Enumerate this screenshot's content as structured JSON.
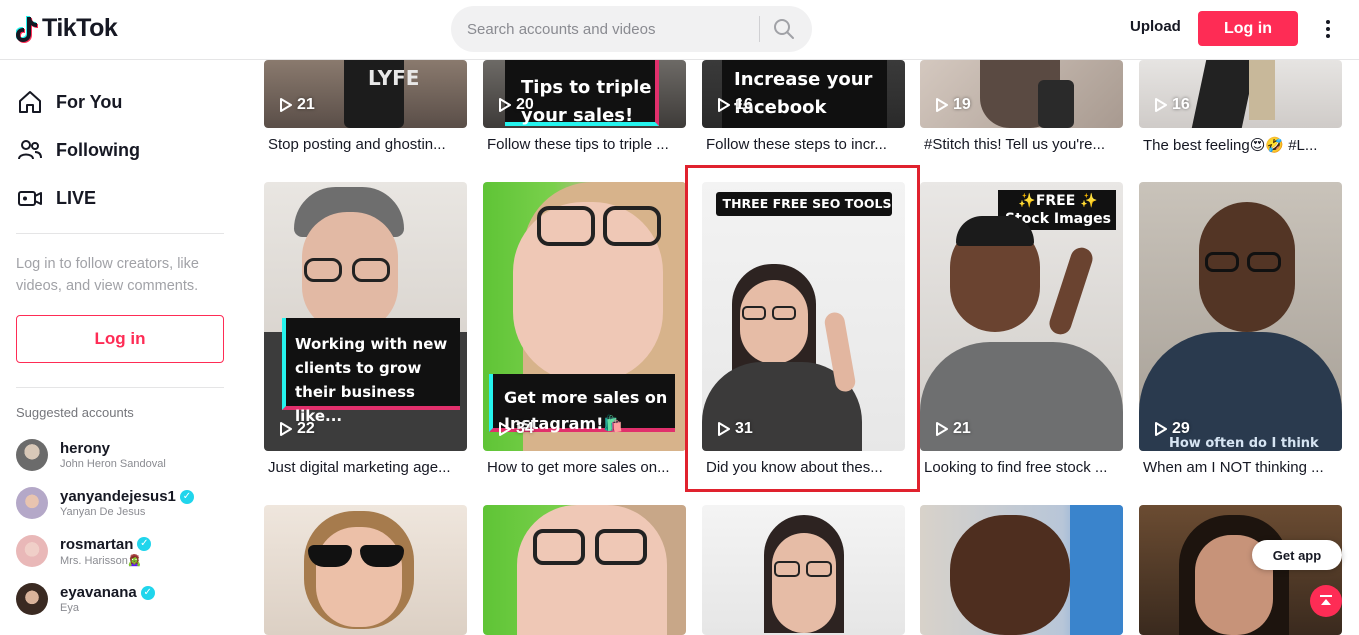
{
  "header": {
    "logo_text": "TikTok",
    "search_placeholder": "Search accounts and videos",
    "upload_label": "Upload",
    "login_label": "Log in"
  },
  "sidebar": {
    "nav": [
      {
        "label": "For You",
        "icon": "home-icon"
      },
      {
        "label": "Following",
        "icon": "users-icon"
      },
      {
        "label": "LIVE",
        "icon": "live-camera-icon"
      }
    ],
    "hint": "Log in to follow creators, like videos, and view comments.",
    "login_label": "Log in",
    "suggested_title": "Suggested accounts",
    "accounts": [
      {
        "username": "herony",
        "name": "John Heron Sandoval",
        "verified": false
      },
      {
        "username": "yanyandejesus1",
        "name": "Yanyan De Jesus",
        "verified": true
      },
      {
        "username": "rosmartan",
        "name": "Mrs. Harisson🧟‍♀️",
        "verified": true
      },
      {
        "username": "eyavanana",
        "name": "Eya",
        "verified": true
      }
    ]
  },
  "videos": [
    {
      "views": "21",
      "caption": "Stop posting and ghostin...",
      "overlay": "LYFE"
    },
    {
      "views": "20",
      "caption": "Follow these tips to triple ...",
      "overlay": "Tips to triple your sales!"
    },
    {
      "views": "16",
      "caption": "Follow these steps to incr...",
      "overlay": "Increase your facebook"
    },
    {
      "views": "19",
      "caption": "#Stitch this! Tell us you're...",
      "overlay": ""
    },
    {
      "views": "16",
      "caption": "The best feeling😍🤣 #L...",
      "overlay": ""
    },
    {
      "views": "22",
      "caption": "Just digital marketing age...",
      "overlay": "Working with new clients to grow their business like..."
    },
    {
      "views": "34",
      "caption": "How to get more sales on...",
      "overlay": "Get more sales on Instagram!🛍️"
    },
    {
      "views": "31",
      "caption": "Did you know about thes...",
      "overlay": "THREE FREE SEO TOOLS"
    },
    {
      "views": "21",
      "caption": "Looking to find free stock ...",
      "overlay": "✨FREE ✨ Stock Images"
    },
    {
      "views": "29",
      "caption": "When am I NOT thinking ...",
      "overlay": "How often do I think"
    }
  ],
  "floating": {
    "get_app_label": "Get app"
  },
  "colors": {
    "brand": "#fe2c55",
    "selection": "#e0222e",
    "verified": "#20d5ec"
  }
}
